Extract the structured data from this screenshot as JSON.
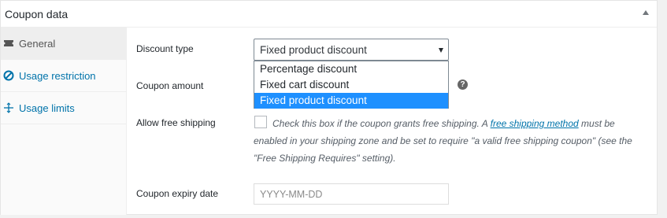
{
  "panel": {
    "title": "Coupon data",
    "toggle_icon": "triangle-up-icon"
  },
  "sidebar": {
    "tabs": [
      {
        "label": "General",
        "icon": "ticket-icon",
        "active": true
      },
      {
        "label": "Usage restriction",
        "icon": "no-entry-icon",
        "active": false
      },
      {
        "label": "Usage limits",
        "icon": "plus-arrows-icon",
        "active": false
      }
    ]
  },
  "form": {
    "discount_type": {
      "label": "Discount type",
      "selected": "Fixed product discount",
      "options": [
        "Percentage discount",
        "Fixed cart discount",
        "Fixed product discount"
      ]
    },
    "coupon_amount": {
      "label": "Coupon amount",
      "help_icon": "question-mark-icon",
      "help_glyph": "?"
    },
    "free_shipping": {
      "label": "Allow free shipping",
      "checked": false,
      "description_before": "Check this box if the coupon grants free shipping. A ",
      "link_text": "free shipping method",
      "description_after": " must be enabled in your shipping zone and be set to require \"a valid free shipping coupon\" (see the \"Free Shipping Requires\" setting)."
    },
    "expiry_date": {
      "label": "Coupon expiry date",
      "placeholder": "YYYY-MM-DD",
      "value": ""
    }
  },
  "colors": {
    "link": "#0073aa",
    "selected_option_bg": "#1e90ff",
    "active_tab_bg": "#eeeeee"
  }
}
